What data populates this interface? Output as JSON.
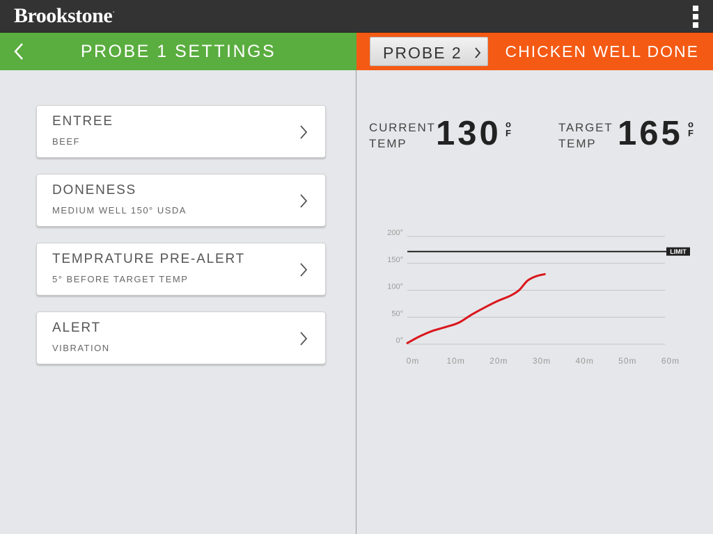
{
  "app": {
    "brand": "Brookstone",
    "brand_mark": "."
  },
  "left_panel": {
    "title": "PROBE 1 SETTINGS",
    "settings": [
      {
        "title": "ENTREE",
        "value": "BEEF"
      },
      {
        "title": "DONENESS",
        "value": "MEDIUM WELL 150° USDA"
      },
      {
        "title": "TEMPRATURE PRE-ALERT",
        "value": "5° BEFORE TARGET TEMP"
      },
      {
        "title": "ALERT",
        "value": "VIBRATION"
      }
    ]
  },
  "right_panel": {
    "probe_button": "PROBE 2",
    "status": "CHICKEN WELL DONE",
    "current": {
      "label_line1": "CURRENT",
      "label_line2": "TEMP",
      "value": "130",
      "unit_top": "o",
      "unit_bottom": "F"
    },
    "target": {
      "label_line1": "TARGET",
      "label_line2": "TEMP",
      "value": "165",
      "unit_top": "o",
      "unit_bottom": "F"
    }
  },
  "colors": {
    "left_header": "#5aad3f",
    "right_header": "#f45a14",
    "top_bar": "#333333",
    "curve": "#d9161c",
    "limit_line": "#222222"
  },
  "icons": {
    "back": "chevron-left-icon",
    "menu": "menu-icon",
    "chevron": "chevron-right-icon"
  },
  "chart_data": {
    "type": "line",
    "title": "",
    "xlabel": "",
    "ylabel": "",
    "x_ticks": [
      "0m",
      "10m",
      "20m",
      "30m",
      "40m",
      "50m",
      "60m"
    ],
    "y_ticks": [
      "0°",
      "50°",
      "100°",
      "150°",
      "200°"
    ],
    "xlim": [
      0,
      60
    ],
    "ylim": [
      0,
      200
    ],
    "grid": true,
    "limit": {
      "label": "LIMIT",
      "value": 172
    },
    "series": [
      {
        "x": [
          0,
          3,
          6,
          9,
          12,
          15,
          18,
          21,
          24,
          26,
          28,
          30,
          32
        ],
        "values": [
          2,
          15,
          25,
          32,
          40,
          55,
          68,
          80,
          90,
          100,
          118,
          126,
          130
        ]
      }
    ]
  }
}
